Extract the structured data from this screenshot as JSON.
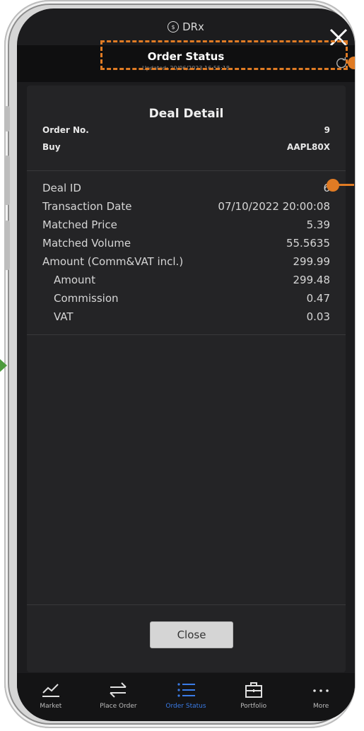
{
  "app": {
    "name": "DRx"
  },
  "header": {
    "title": "Order Status",
    "updated": "Updated: 20/06/2023 16:55:18"
  },
  "deal": {
    "title": "Deal Detail",
    "order_no_label": "Order No.",
    "order_no": "9",
    "side_label": "Buy",
    "symbol": "AAPL80X",
    "rows": [
      {
        "label": "Deal ID",
        "value": "6"
      },
      {
        "label": "Transaction Date",
        "value": "07/10/2022 20:00:08"
      },
      {
        "label": "Matched Price",
        "value": "5.39"
      },
      {
        "label": "Matched Volume",
        "value": "55.5635"
      },
      {
        "label": "Amount (Comm&VAT incl.)",
        "value": "299.99"
      },
      {
        "label": "Amount",
        "value": "299.48"
      },
      {
        "label": "Commission",
        "value": "0.47"
      },
      {
        "label": "VAT",
        "value": "0.03"
      }
    ],
    "close_label": "Close"
  },
  "tabs": [
    {
      "label": "Market",
      "icon": "chart-line-icon"
    },
    {
      "label": "Place Order",
      "icon": "swap-arrows-icon"
    },
    {
      "label": "Order Status",
      "icon": "list-icon"
    },
    {
      "label": "Portfolio",
      "icon": "briefcase-icon"
    },
    {
      "label": "More",
      "icon": "more-dots-icon"
    }
  ],
  "colors": {
    "accent": "#3a7be6",
    "annotation": "#e07b24",
    "arrow": "#4c9a3c"
  }
}
